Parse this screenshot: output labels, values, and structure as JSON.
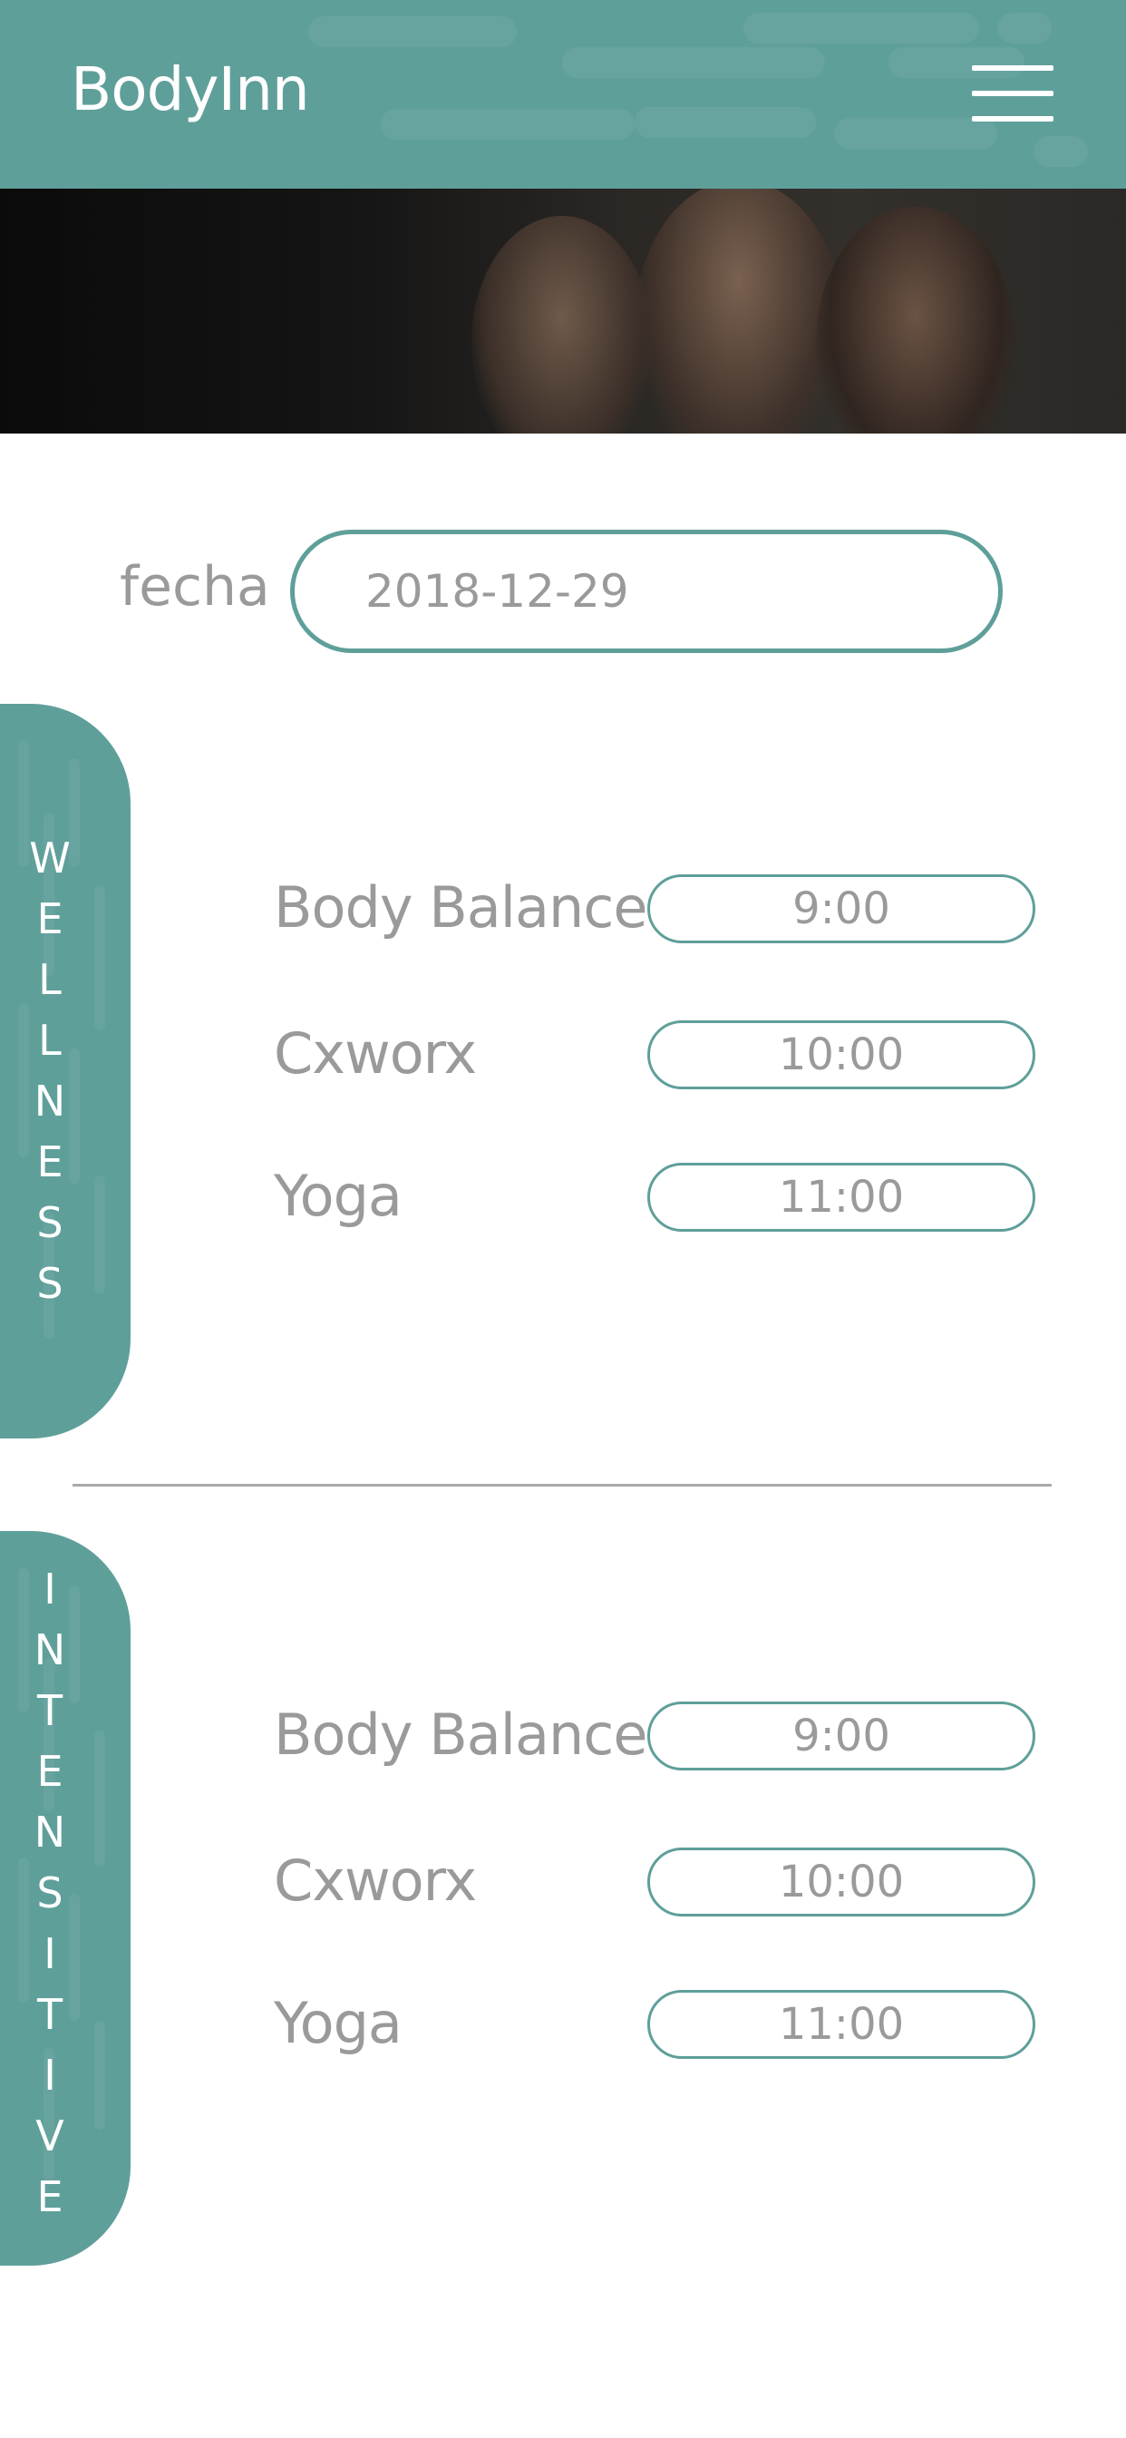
{
  "app": {
    "title": "BodyInn"
  },
  "icons": {
    "menu": "hamburger-menu-icon"
  },
  "colors": {
    "brand": "#5f9f9a",
    "text_muted": "#9a9a9a",
    "background": "#ffffff"
  },
  "date_filter": {
    "label": "fecha",
    "value": "2018-12-29"
  },
  "sections": [
    {
      "category": "WELLNESS",
      "classes": [
        {
          "name": "Body Balance",
          "time": "9:00"
        },
        {
          "name": "Cxworx",
          "time": "10:00"
        },
        {
          "name": "Yoga",
          "time": "11:00"
        }
      ]
    },
    {
      "category": "INTENSITIVE",
      "classes": [
        {
          "name": "Body Balance",
          "time": "9:00"
        },
        {
          "name": "Cxworx",
          "time": "10:00"
        },
        {
          "name": "Yoga",
          "time": "11:00"
        }
      ]
    }
  ]
}
